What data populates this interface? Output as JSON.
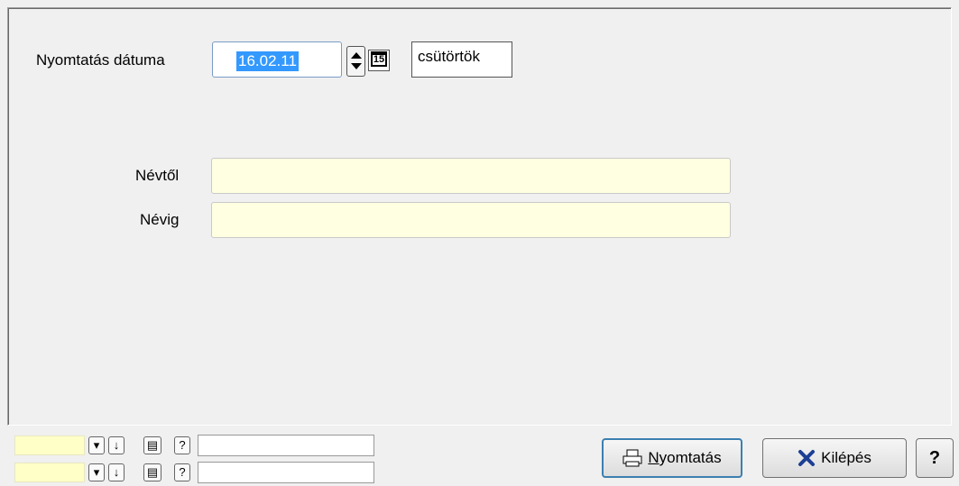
{
  "form": {
    "date_label": "Nyomtatás dátuma",
    "date_value": "16.02.11",
    "calendar_glyph": "15",
    "weekday": "csütörtök",
    "from_label": "Névtől",
    "to_label": "Névig",
    "from_value": "",
    "to_value": ""
  },
  "filters": [
    {
      "help": "?"
    },
    {
      "help": "?"
    }
  ],
  "buttons": {
    "print_first": "N",
    "print_rest": "yomtatás",
    "exit": "Kilépés",
    "help": "?"
  },
  "colors": {
    "selection": "#3399ff",
    "input_bg": "#ffffe1",
    "exit_icon": "#1c3f94"
  }
}
